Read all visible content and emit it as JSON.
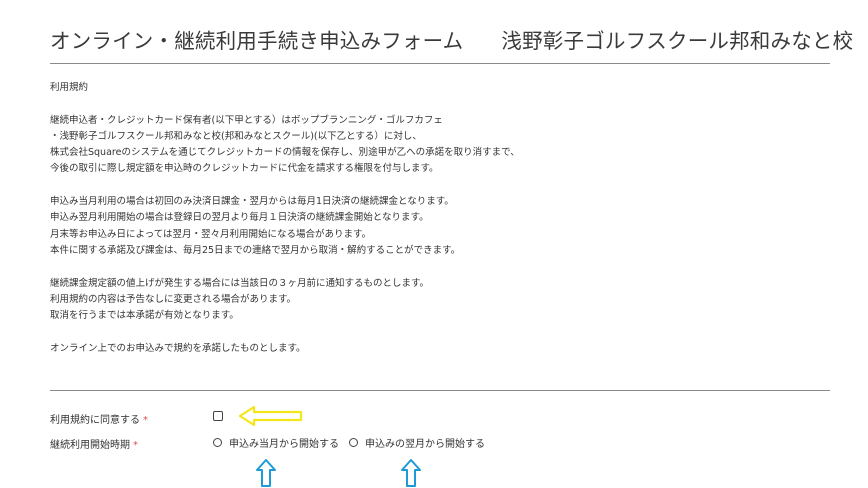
{
  "header": {
    "form_title": "オンライン・継続利用手続き申込みフォーム",
    "school_name": "浅野彰子ゴルフスクール邦和みなと校"
  },
  "terms": {
    "heading": "利用規約",
    "lines": [
      "継続申込者・クレジットカード保有者(以下甲とする）はボップブランニング・ゴルフカフェ",
      "・浅野彰子ゴルフスクール邦和みなと校(邦和みなとスクール)(以下乙とする）に対し、",
      "株式会社Squareのシステムを通じてクレジットカードの情報を保存し、別途甲が乙への承諾を取り消すまで、",
      "今後の取引に際し規定額を申込時のクレジットカードに代金を請求する権限を付与します。",
      "",
      "申込み当月利用の場合は初回のみ決済日課金・翌月からは毎月1日決済の継続課金となります。",
      "申込み翌月利用開始の場合は登録日の翌月より毎月１日決済の継続課金開始となります。",
      "月末等お申込み日によっては翌月・翌々月利用開始になる場合があります。",
      "本件に関する承諾及び課金は、毎月25日までの連絡で翌月から取消・解約することができます。",
      "",
      "継続課金規定額の値上げが発生する場合には当該日の３ヶ月前に通知するものとします。",
      "利用規約の内容は予告なしに変更される場合があります。",
      "取消を行うまでは本承諾が有効となります。",
      "",
      "オンライン上でのお申込みで規約を承諾したものとします。"
    ]
  },
  "form": {
    "agree_label": "利用規約に同意する",
    "start_label": "継続利用開始時期",
    "required_mark": "*",
    "agree_checked": false,
    "start_options": [
      "申込み当月から開始する",
      "申込みの翌月から開始する"
    ]
  },
  "colors": {
    "required": "#d9534f",
    "yellow_arrow": "#f5e61a",
    "blue_arrow": "#1e9ad6"
  },
  "icons": [
    "yellow-left-arrow-icon",
    "blue-up-arrow-icon"
  ]
}
